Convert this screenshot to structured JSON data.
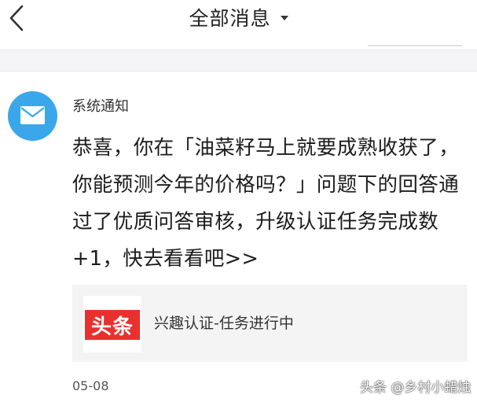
{
  "header": {
    "title": "全部消息"
  },
  "notification": {
    "sender": "系统通知",
    "message": "恭喜，你在「油菜籽马上就要成熟收获了，你能预测今年的价格吗？」问题下的回答通过了优质问答审核，升级认证任务完成数+1，快去看看吧>>",
    "card": {
      "logo_text": "头条",
      "text": "兴趣认证-任务进行中"
    },
    "date": "05-08"
  },
  "watermark": "头条 @乡村小蜡烛",
  "colors": {
    "avatar": "#3aa7ea",
    "logo": "#e8312f",
    "card_bg": "#f4f4f4"
  },
  "icons": {
    "back": "chevron-left-icon",
    "dropdown": "caret-down-icon",
    "avatar": "mail-envelope-icon"
  }
}
